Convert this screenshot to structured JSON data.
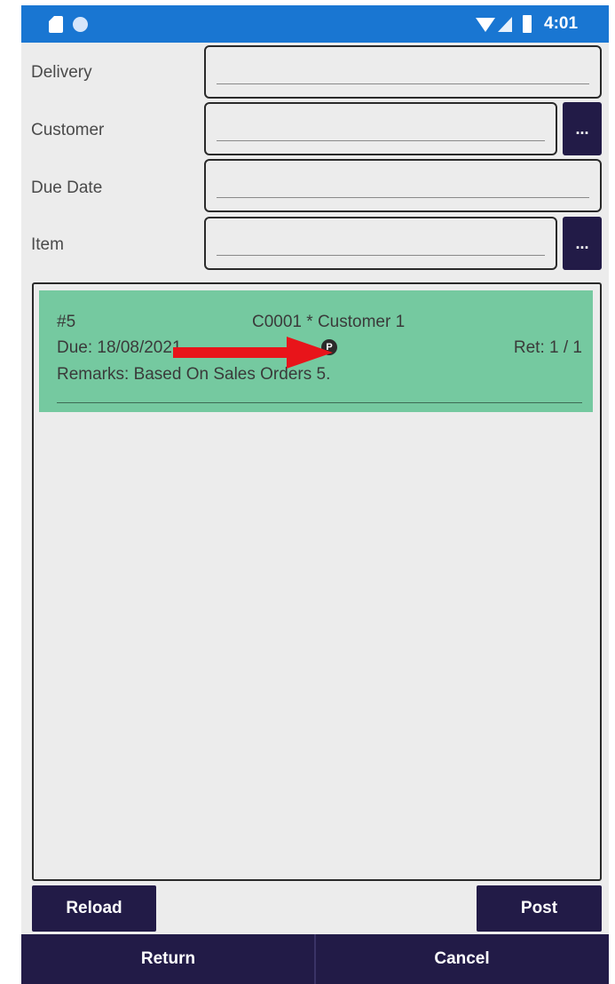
{
  "status_bar": {
    "time": "4:01",
    "icons": [
      "sd-card-icon",
      "notification-dot-icon",
      "wifi-icon",
      "signal-icon",
      "battery-icon"
    ],
    "background": "#1976d2"
  },
  "form": {
    "delivery_label": "Delivery",
    "delivery_value": "",
    "customer_label": "Customer",
    "customer_value": "",
    "customer_more": "...",
    "due_date_label": "Due Date",
    "due_date_value": "",
    "item_label": "Item",
    "item_value": "",
    "item_more": "..."
  },
  "list": {
    "items": [
      {
        "number": "#5",
        "customer": "C0001 * Customer 1",
        "due": "Due: 18/08/2021",
        "status_icon": "P",
        "ret": "Ret: 1 / 1",
        "remarks": "Remarks: Based On Sales Orders 5.",
        "color": "#75c9a0"
      }
    ]
  },
  "annotation": {
    "arrow_color": "#e8141a"
  },
  "actions": {
    "reload": "Reload",
    "post": "Post",
    "return": "Return",
    "cancel": "Cancel"
  },
  "colors": {
    "button_dark": "#221b47",
    "background": "#ececec"
  }
}
